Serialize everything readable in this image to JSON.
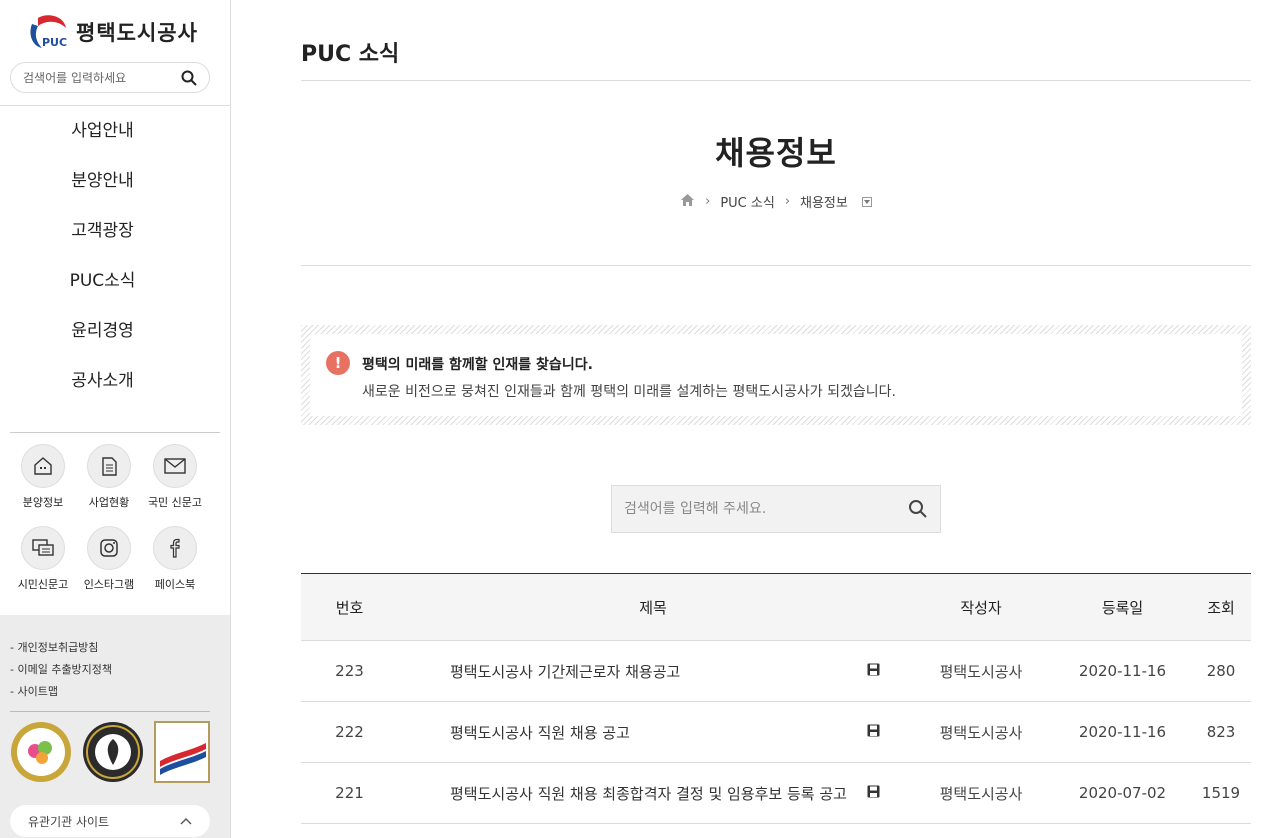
{
  "brand": {
    "name": "평택도시공사",
    "mark_text": "PUC"
  },
  "sidebar": {
    "search": {
      "placeholder": "검색어를 입력하세요"
    },
    "menu": [
      "사업안내",
      "분양안내",
      "고객광장",
      "PUC소식",
      "윤리경영",
      "공사소개"
    ],
    "quick": [
      {
        "label": "분양정보",
        "icon": "house-icon"
      },
      {
        "label": "사업현황",
        "icon": "document-icon"
      },
      {
        "label": "국민 신문고",
        "icon": "envelope-icon"
      },
      {
        "label": "시민신문고",
        "icon": "chat-icon"
      },
      {
        "label": "인스타그램",
        "icon": "instagram-icon"
      },
      {
        "label": "페이스북",
        "icon": "facebook-icon"
      }
    ],
    "policy": [
      "- 개인정보취급방침",
      "- 이메일 추출방지정책",
      "- 사이트맵"
    ],
    "family_site": "유관기관 사이트"
  },
  "main": {
    "section_title": "PUC 소식",
    "page_title": "채용정보",
    "breadcrumb": [
      "PUC 소식",
      "채용정보"
    ],
    "notice": {
      "headline": "평택의 미래를 함께할 인재를 찾습니다.",
      "body": "새로운 비전으로 뭉쳐진 인재들과 함께 평택의 미래를 설계하는 평택도시공사가 되겠습니다."
    },
    "search": {
      "placeholder": "검색어를 입력해 주세요."
    },
    "table": {
      "headers": [
        "번호",
        "제목",
        "작성자",
        "등록일",
        "조회"
      ],
      "rows": [
        {
          "no": "223",
          "title": "평택도시공사 기간제근로자 채용공고",
          "author": "평택도시공사",
          "date": "2020-11-16",
          "views": "280"
        },
        {
          "no": "222",
          "title": "평택도시공사 직원 채용 공고",
          "author": "평택도시공사",
          "date": "2020-11-16",
          "views": "823"
        },
        {
          "no": "221",
          "title": "평택도시공사 직원 채용 최종합격자 결정 및 임용후보 등록 공고",
          "author": "평택도시공사",
          "date": "2020-07-02",
          "views": "1519"
        }
      ]
    }
  },
  "colors": {
    "accent": "#e87262",
    "brand_red": "#d7282f",
    "brand_blue": "#1f4e9c"
  }
}
